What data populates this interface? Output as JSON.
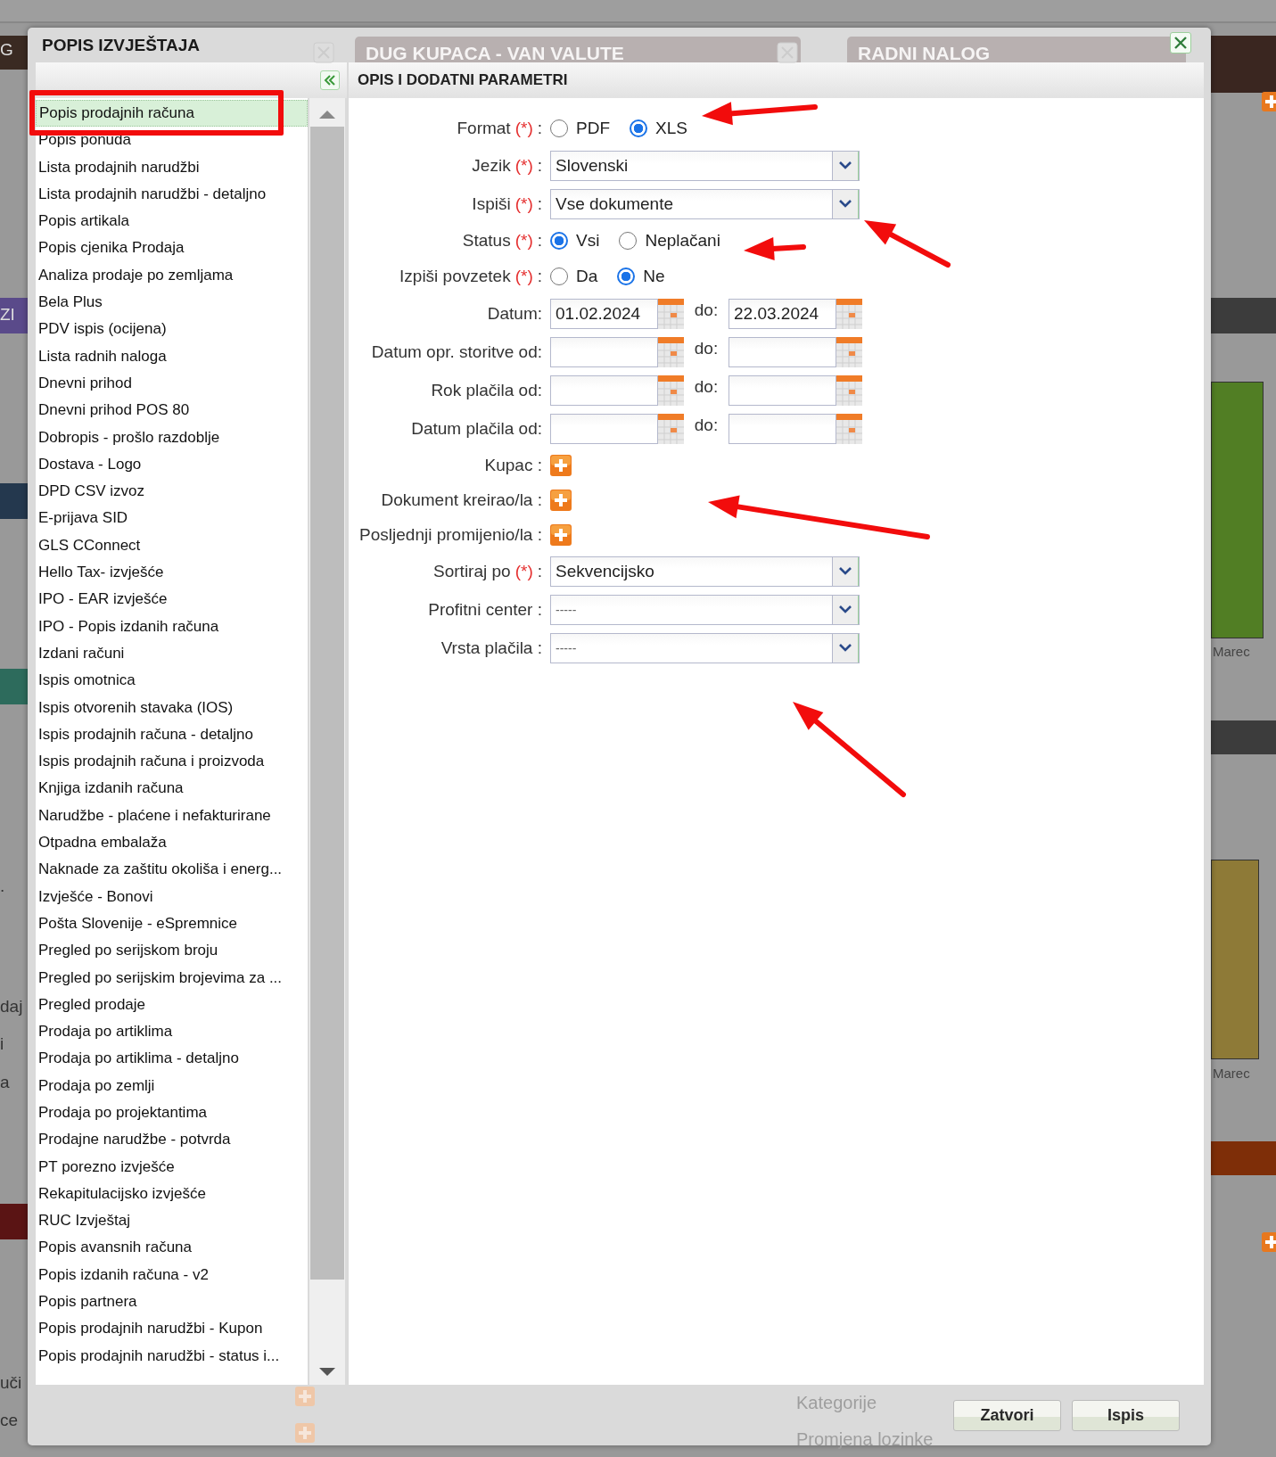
{
  "background": {
    "fragments": [
      "G",
      "ZI",
      ".",
      "daj",
      "i",
      "a",
      "uči",
      "ce"
    ],
    "chart_labels": [
      "Marec",
      "Marec"
    ],
    "tabs": [
      {
        "title": "DUG KUPACA - VAN VALUTE"
      },
      {
        "title": "RADNI NALOG"
      }
    ],
    "menu_items": [
      "Kategorije",
      "Promjena lozinke"
    ]
  },
  "dialog": {
    "title": "POPIS IZVJEŠTAJA",
    "list_items": [
      {
        "label": "Popis prodajnih računa",
        "selected": true
      },
      {
        "label": "Popis ponuda",
        "selected": false
      },
      {
        "label": "Lista prodajnih narudžbi",
        "selected": false
      },
      {
        "label": "Lista prodajnih narudžbi - detaljno",
        "selected": false
      },
      {
        "label": "Popis artikala",
        "selected": false
      },
      {
        "label": "Popis cjenika Prodaja",
        "selected": false
      },
      {
        "label": "Analiza prodaje po zemljama",
        "selected": false
      },
      {
        "label": "Bela Plus",
        "selected": false
      },
      {
        "label": "PDV ispis (ocijena)",
        "selected": false
      },
      {
        "label": "Lista radnih naloga",
        "selected": false
      },
      {
        "label": "Dnevni prihod",
        "selected": false
      },
      {
        "label": "Dnevni prihod POS 80",
        "selected": false
      },
      {
        "label": "Dobropis - prošlo razdoblje",
        "selected": false
      },
      {
        "label": "Dostava - Logo",
        "selected": false
      },
      {
        "label": "DPD CSV izvoz",
        "selected": false
      },
      {
        "label": "E-prijava SID",
        "selected": false
      },
      {
        "label": "GLS CConnect",
        "selected": false
      },
      {
        "label": "Hello Tax- izvješće",
        "selected": false
      },
      {
        "label": "IPO - EAR izvješće",
        "selected": false
      },
      {
        "label": "IPO - Popis izdanih računa",
        "selected": false
      },
      {
        "label": "Izdani računi",
        "selected": false
      },
      {
        "label": "Ispis omotnica",
        "selected": false
      },
      {
        "label": "Ispis otvorenih stavaka (IOS)",
        "selected": false
      },
      {
        "label": "Ispis prodajnih računa - detaljno",
        "selected": false
      },
      {
        "label": "Ispis prodajnih računa i proizvoda",
        "selected": false
      },
      {
        "label": "Knjiga izdanih računa",
        "selected": false
      },
      {
        "label": "Narudžbe - plaćene i nefakturirane",
        "selected": false
      },
      {
        "label": "Otpadna embalaža",
        "selected": false
      },
      {
        "label": "Naknade za zaštitu okoliša i energ...",
        "selected": false
      },
      {
        "label": "Izvješće - Bonovi",
        "selected": false
      },
      {
        "label": "Pošta Slovenije - eSpremnice",
        "selected": false
      },
      {
        "label": "Pregled po serijskom broju",
        "selected": false
      },
      {
        "label": "Pregled po serijskim brojevima za ...",
        "selected": false
      },
      {
        "label": "Pregled prodaje",
        "selected": false
      },
      {
        "label": "Prodaja po artiklima",
        "selected": false
      },
      {
        "label": "Prodaja po artiklima - detaljno",
        "selected": false
      },
      {
        "label": "Prodaja po zemlji",
        "selected": false
      },
      {
        "label": "Prodaja po projektantima",
        "selected": false
      },
      {
        "label": "Prodajne narudžbe - potvrda",
        "selected": false
      },
      {
        "label": "PT porezno izvješće",
        "selected": false
      },
      {
        "label": "Rekapitulacijsko izvješće",
        "selected": false
      },
      {
        "label": "RUC Izvještaj",
        "selected": false
      },
      {
        "label": "Popis avansnih računa",
        "selected": false
      },
      {
        "label": "Popis izdanih računa - v2",
        "selected": false
      },
      {
        "label": "Popis partnera",
        "selected": false
      },
      {
        "label": "Popis prodajnih narudžbi - Kupon",
        "selected": false
      },
      {
        "label": "Popis prodajnih narudžbi - status i...",
        "selected": false
      }
    ],
    "panel_title": "OPIS I DODATNI PARAMETRI",
    "fields": [
      {
        "kind": "radio",
        "label": "Format",
        "required_mark": "(*)",
        "separator": ":",
        "options": [
          {
            "label": "PDF",
            "selected": false
          },
          {
            "label": "XLS",
            "selected": true
          }
        ]
      },
      {
        "kind": "select",
        "label": "Jezik",
        "required_mark": "(*)",
        "separator": ":",
        "value": "Slovenski"
      },
      {
        "kind": "select",
        "label": "Ispiši",
        "required_mark": "(*)",
        "separator": ":",
        "value": "Vse dokumente"
      },
      {
        "kind": "radio",
        "label": "Status",
        "required_mark": "(*)",
        "separator": ":",
        "options": [
          {
            "label": "Vsi",
            "selected": true
          },
          {
            "label": "Neplačani",
            "selected": false
          }
        ]
      },
      {
        "kind": "radio",
        "label": "Izpiši povzetek",
        "required_mark": "(*)",
        "separator": ":",
        "options": [
          {
            "label": "Da",
            "selected": false
          },
          {
            "label": "Ne",
            "selected": true
          }
        ]
      },
      {
        "kind": "daterange",
        "label": "Datum:",
        "from": "01.02.2024",
        "to_label": "do:",
        "to": "22.03.2024"
      },
      {
        "kind": "daterange",
        "label": "Datum opr. storitve od:",
        "to_label": "do:"
      },
      {
        "kind": "daterange",
        "label": "Rok plačila od:",
        "to_label": "do:"
      },
      {
        "kind": "daterange",
        "label": "Datum plačila od:",
        "to_label": "do:"
      },
      {
        "kind": "add",
        "label": "Kupac :"
      },
      {
        "kind": "add",
        "label": "Dokument kreirao/la :"
      },
      {
        "kind": "add",
        "label": "Posljednji promijenio/la :"
      },
      {
        "kind": "select",
        "label": "Sortiraj po",
        "required_mark": "(*)",
        "separator": ":",
        "value": "Sekvencijsko"
      },
      {
        "kind": "select",
        "label": "Profitni center :",
        "placeholder": "-----"
      },
      {
        "kind": "select",
        "label": "Vrsta plačila :",
        "placeholder": "-----"
      }
    ],
    "buttons": [
      "Zatvori",
      "Ispis"
    ]
  }
}
